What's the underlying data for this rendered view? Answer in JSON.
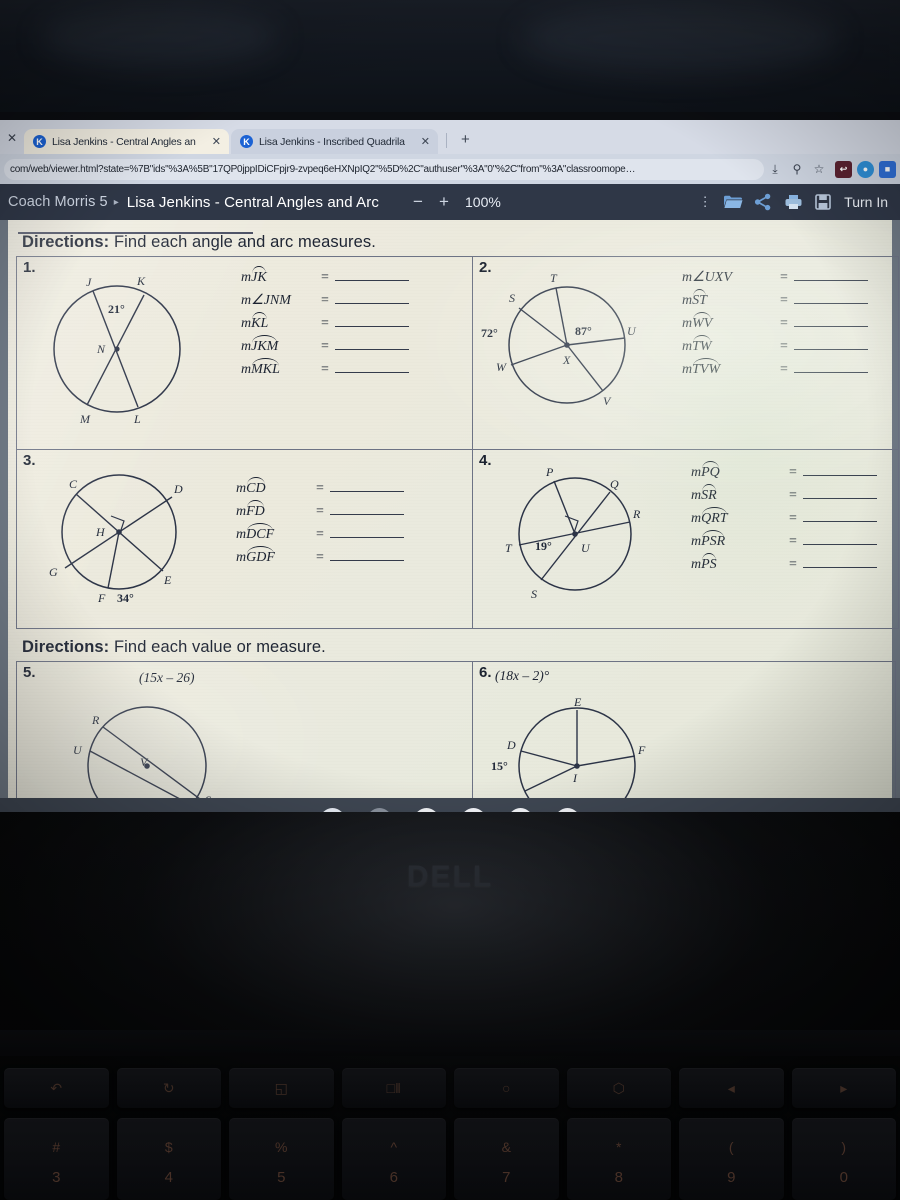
{
  "browser": {
    "tabs": [
      {
        "favicon_letter": "K",
        "title": "Lisa Jenkins - Central Angles an",
        "close": "✕",
        "active": true
      },
      {
        "favicon_letter": "K",
        "title": "Lisa Jenkins - Inscribed Quadrila",
        "close": "✕",
        "active": false
      }
    ],
    "left_edge_close": "✕",
    "new_tab": "+",
    "omnibox": {
      "url": "com/web/viewer.html?state=%7B\"ids\"%3A%5B\"17QP0jppIDiCFpjr9-zvpeq6eHXNpIQ2\"%5D%2C\"authuser\"%3A\"0\"%2C\"from\"%3A\"classroomope…",
      "icons": [
        "download-icon",
        "zoom-icon",
        "bookmark-star-icon"
      ]
    },
    "extensions": [
      {
        "name": "extension-icon-1",
        "letter": "↩",
        "color": "#5b2230"
      },
      {
        "name": "extension-icon-2",
        "letter": "●",
        "color": "#2f90d8"
      },
      {
        "name": "extension-icon-3",
        "letter": "■",
        "color": "#2f6fd8"
      }
    ]
  },
  "app_toolbar": {
    "breadcrumb_class": "Coach Morris 5",
    "breadcrumb_arrow": "▸",
    "document_title": "Lisa Jenkins - Central Angles and Arc",
    "zoom_out": "−",
    "zoom_in": "+",
    "zoom_level": "100%",
    "more_menu": "⋮",
    "icons": [
      "folder-icon",
      "share-icon",
      "print-icon",
      "save-icon"
    ],
    "turn_in_label": "Turn In"
  },
  "worksheet": {
    "directions_1_label": "Directions:",
    "directions_1_text": "Find each angle and arc measures.",
    "directions_2_label": "Directions:",
    "directions_2_text": "Find each value or measure.",
    "problems": [
      {
        "number": "1.",
        "center": "N",
        "points": [
          "J",
          "K",
          "N",
          "M",
          "L"
        ],
        "angles": [
          "21°"
        ],
        "answers": [
          {
            "prefix": "m",
            "arc": "JK",
            "suffix": "",
            "eq": "=",
            "value": ""
          },
          {
            "prefix": "m∠",
            "arc": "",
            "suffix": "JNM",
            "eq": "=",
            "value": ""
          },
          {
            "prefix": "m",
            "arc": "KL",
            "suffix": "",
            "eq": "=",
            "value": ""
          },
          {
            "prefix": "m",
            "arc": "JKM",
            "suffix": "",
            "eq": "=",
            "value": ""
          },
          {
            "prefix": "m",
            "arc": "MKL",
            "suffix": "",
            "eq": "=",
            "value": ""
          }
        ]
      },
      {
        "number": "2.",
        "center": "X",
        "points": [
          "S",
          "T",
          "U",
          "V",
          "W",
          "X"
        ],
        "angles": [
          "72°",
          "87°"
        ],
        "answers": [
          {
            "prefix": "m∠",
            "arc": "",
            "suffix": "UXV",
            "eq": "=",
            "value": ""
          },
          {
            "prefix": "m",
            "arc": "ST",
            "suffix": "",
            "eq": "=",
            "value": ""
          },
          {
            "prefix": "m",
            "arc": "WV",
            "suffix": "",
            "eq": "=",
            "value": ""
          },
          {
            "prefix": "m",
            "arc": "TW",
            "suffix": "",
            "eq": "=",
            "value": ""
          },
          {
            "prefix": "m",
            "arc": "TVW",
            "suffix": "",
            "eq": "=",
            "value": ""
          }
        ]
      },
      {
        "number": "3.",
        "center": "H",
        "points": [
          "C",
          "D",
          "E",
          "F",
          "G",
          "H"
        ],
        "angles": [
          "34°"
        ],
        "right_angle": true,
        "answers": [
          {
            "prefix": "m",
            "arc": "CD",
            "suffix": "",
            "eq": "=",
            "value": ""
          },
          {
            "prefix": "m",
            "arc": "FD",
            "suffix": "",
            "eq": "=",
            "value": ""
          },
          {
            "prefix": "m",
            "arc": "DCF",
            "suffix": "",
            "eq": "=",
            "value": ""
          },
          {
            "prefix": "m",
            "arc": "GDF",
            "suffix": "",
            "eq": "=",
            "value": ""
          }
        ]
      },
      {
        "number": "4.",
        "center": "U",
        "points": [
          "P",
          "Q",
          "R",
          "S",
          "T",
          "U"
        ],
        "angles": [
          "19°"
        ],
        "right_angle": true,
        "answers": [
          {
            "prefix": "m",
            "arc": "PQ",
            "suffix": "",
            "eq": "=",
            "value": ""
          },
          {
            "prefix": "m",
            "arc": "SR",
            "suffix": "",
            "eq": "=",
            "value": ""
          },
          {
            "prefix": "m",
            "arc": "QRT",
            "suffix": "",
            "eq": "=",
            "value": ""
          },
          {
            "prefix": "m",
            "arc": "PSR",
            "suffix": "",
            "eq": "=",
            "value": ""
          },
          {
            "prefix": "m",
            "arc": "PS",
            "suffix": "",
            "eq": "=",
            "value": ""
          }
        ]
      },
      {
        "number": "5.",
        "center": "V",
        "points": [
          "R",
          "S",
          "U",
          "V"
        ],
        "expression": "(15x – 26)",
        "answers": []
      },
      {
        "number": "6.",
        "center": "I",
        "points": [
          "D",
          "E",
          "F",
          "I"
        ],
        "expression": "(18x – 2)°",
        "angles": [
          "15°"
        ],
        "answers": []
      }
    ]
  },
  "shelf": {
    "icons": [
      {
        "name": "launcher-icon",
        "letter": "◳",
        "bg": "#e9eef6",
        "fg": "#3b6ea8"
      },
      {
        "name": "brainly-app-icon",
        "letter": "B",
        "bg": "#8a929e",
        "fg": "#e8ecf2"
      },
      {
        "name": "chrome-icon",
        "letter": "●",
        "bg": "#f1f3f6",
        "fg": "#2a7de1"
      },
      {
        "name": "docs-icon",
        "letter": "▤",
        "bg": "#f4f6fa",
        "fg": "#2f8fe0"
      },
      {
        "name": "play-store-icon",
        "letter": "▶",
        "bg": "#f4f6fa",
        "fg": "#3ba45c"
      },
      {
        "name": "display-app-icon",
        "letter": "▣",
        "bg": "#f2f4f8",
        "fg": "#46506a"
      }
    ]
  },
  "laptop": {
    "brand": "DELL",
    "fn_keys": [
      "↶",
      "↻",
      "◱",
      "□‖",
      "○",
      "⬡",
      "◂",
      "▸"
    ],
    "number_keys": [
      {
        "sym": "#",
        "num": "3"
      },
      {
        "sym": "$",
        "num": "4"
      },
      {
        "sym": "%",
        "num": "5"
      },
      {
        "sym": "^",
        "num": "6"
      },
      {
        "sym": "&",
        "num": "7"
      },
      {
        "sym": "*",
        "num": "8"
      },
      {
        "sym": "(",
        "num": "9"
      },
      {
        "sym": ")",
        "num": "0"
      }
    ]
  }
}
